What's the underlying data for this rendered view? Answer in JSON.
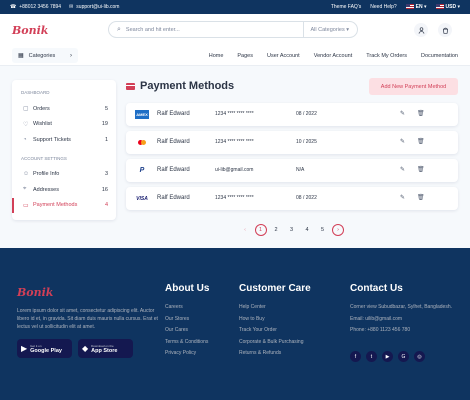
{
  "topbar": {
    "phone": "+88012 3456 7894",
    "email": "support@ui-lib.com",
    "theme_faq": "Theme FAQ's",
    "help": "Need Help?",
    "language": "EN",
    "currency": "USD"
  },
  "header": {
    "logo": "Bonik",
    "search_placeholder": "Search and hit enter...",
    "category_select": "All Categories"
  },
  "nav": {
    "categories_label": "Categories",
    "links": [
      "Home",
      "Pages",
      "User Account",
      "Vendor Account",
      "Track My Orders",
      "Documentation"
    ]
  },
  "sidebar": {
    "dashboard_heading": "DASHBOARD",
    "dashboard_items": [
      {
        "label": "Orders",
        "count": "5",
        "icon": "bag-icon"
      },
      {
        "label": "Wishlist",
        "count": "19",
        "icon": "heart-icon"
      },
      {
        "label": "Support Tickets",
        "count": "1",
        "icon": "headset-icon"
      }
    ],
    "settings_heading": "ACCOUNT SETTINGS",
    "settings_items": [
      {
        "label": "Profile Info",
        "count": "3",
        "icon": "person-icon"
      },
      {
        "label": "Addresses",
        "count": "16",
        "icon": "location-icon"
      },
      {
        "label": "Payment Methods",
        "count": "4",
        "icon": "card-icon",
        "active": true
      }
    ]
  },
  "main": {
    "title": "Payment Methods",
    "add_button": "Add New Payment Method",
    "cards": [
      {
        "brand": "amex",
        "brand_label": "AMEX",
        "name": "Ralf Edward",
        "number": "1234 **** **** ****",
        "expiry": "08 / 2022"
      },
      {
        "brand": "mastercard",
        "brand_label": "",
        "name": "Ralf Edward",
        "number": "1234 **** **** ****",
        "expiry": "10 / 2025"
      },
      {
        "brand": "paypal",
        "brand_label": "P",
        "name": "Ralf Edward",
        "number": "ui-lib@gmail.com",
        "expiry": "N/A"
      },
      {
        "brand": "visa",
        "brand_label": "VISA",
        "name": "Ralf Edward",
        "number": "1234 **** **** ****",
        "expiry": "08 / 2022"
      }
    ],
    "pagination": {
      "pages": [
        "1",
        "2",
        "3",
        "4",
        "5"
      ],
      "current": "1"
    }
  },
  "footer": {
    "logo": "Bonik",
    "description": "Lorem ipsum dolor sit amet, consectetur adipiscing elit. Auctor libero id et, in gravida. Sit diam duis mauris nulla cursus. Erat et lectus vel ut sollicitudin elit at amet.",
    "google_play": {
      "small": "Get it on",
      "big": "Google Play"
    },
    "app_store": {
      "small": "Download on the",
      "big": "App Store"
    },
    "about": {
      "title": "About Us",
      "links": [
        "Careers",
        "Our Stores",
        "Our Cares",
        "Terms & Conditions",
        "Privacy Policy"
      ]
    },
    "care": {
      "title": "Customer Care",
      "links": [
        "Help Center",
        "How to Buy",
        "Track Your Order",
        "Corporate & Bulk Purchasing",
        "Returns & Refunds"
      ]
    },
    "contact": {
      "title": "Contact Us",
      "address": "Corner view Subudbazar, Sylhet, Bangladesh.",
      "email": "Email: uilib@gmail.com",
      "phone": "Phone: +880 1123 456 780"
    },
    "socials": [
      "facebook-icon",
      "twitter-icon",
      "youtube-icon",
      "google-icon",
      "instagram-icon"
    ]
  },
  "colors": {
    "primary": "#d23f57",
    "navy": "#0f3460",
    "background": "#f6f9fc"
  }
}
